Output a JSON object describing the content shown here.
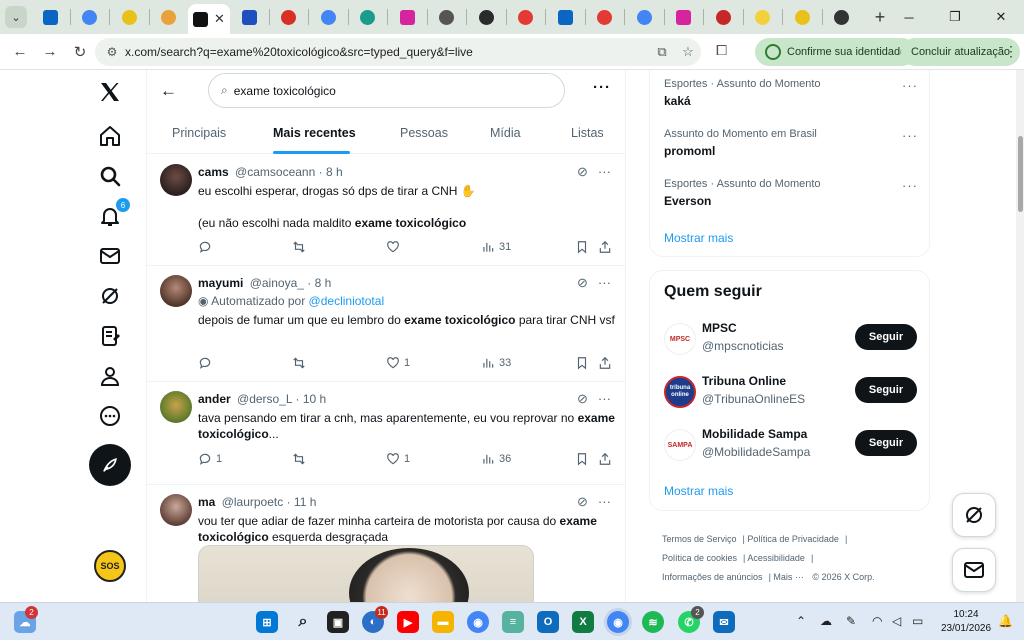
{
  "browser": {
    "tabs": [
      {
        "icon": "linkedin-icon",
        "color": "#0a66c2",
        "round": false
      },
      {
        "icon": "chrome-icon",
        "color": "#4285f4",
        "round": true
      },
      {
        "icon": "custom-icon",
        "color": "#e8c21a",
        "round": true
      },
      {
        "icon": "d-icon",
        "color": "#e9a23b",
        "round": true
      },
      {
        "icon": "x-icon",
        "color": "#111111",
        "round": false,
        "active": true
      },
      {
        "icon": "news-icon",
        "color": "#1f4fbf",
        "round": false
      },
      {
        "icon": "l-icon",
        "color": "#d93025",
        "round": true
      },
      {
        "icon": "google-icon",
        "color": "#4285f4",
        "round": true
      },
      {
        "icon": "globe-icon",
        "color": "#1a9c8c",
        "round": true
      },
      {
        "icon": "instagram-icon",
        "color": "#d6249f",
        "round": false
      },
      {
        "icon": "grid-icon",
        "color": "#555555",
        "round": true
      },
      {
        "icon": "dark-icon",
        "color": "#2b2b2b",
        "round": true
      },
      {
        "icon": "brand-icon",
        "color": "#e53935",
        "round": true
      },
      {
        "icon": "linkedin-icon",
        "color": "#0a66c2",
        "round": false
      },
      {
        "icon": "brand-icon",
        "color": "#e53935",
        "round": true
      },
      {
        "icon": "google-icon",
        "color": "#4285f4",
        "round": true
      },
      {
        "icon": "instagram-icon",
        "color": "#d6249f",
        "round": false
      },
      {
        "icon": "r-icon",
        "color": "#c62828",
        "round": true
      },
      {
        "icon": "yellow-icon",
        "color": "#f2d13a",
        "round": true
      },
      {
        "icon": "custom-icon",
        "color": "#e8c21a",
        "round": true
      },
      {
        "icon": "github-icon",
        "color": "#333333",
        "round": true
      }
    ],
    "new_tab": "+",
    "url": "x.com/search?q=exame%20toxicológico&src=typed_query&f=live",
    "identity_label": "Confirme sua identidade",
    "update_label": "Concluir atualização"
  },
  "search": {
    "query": "exame toxicológico"
  },
  "search_tabs": [
    {
      "label": "Principais",
      "active": false
    },
    {
      "label": "Mais recentes",
      "active": true
    },
    {
      "label": "Pessoas",
      "active": false
    },
    {
      "label": "Mídia",
      "active": false
    },
    {
      "label": "Listas",
      "active": false
    }
  ],
  "nav": {
    "notifications_badge": "6",
    "sos_label": "SOS"
  },
  "posts": [
    {
      "name": "cams",
      "handle": "@camsoceann",
      "time": "· 8 h",
      "text_line1": "eu escolhi esperar, drogas só dps de tirar a CNH ✋",
      "text_line2_pre": "(eu não escolhi nada maldito ",
      "text_line2_bold": "exame toxicológico",
      "replies": "",
      "reposts": "",
      "likes": "",
      "views": "31",
      "avatar_color": "#3a2a2a"
    },
    {
      "name": "mayumi",
      "handle": "@ainoya_",
      "time": "· 8 h",
      "automated_prefix": "Automatizado por ",
      "automated_link": "@decliniototal",
      "text_pre": "depois de fumar um que eu lembro do ",
      "text_bold": "exame toxicológico",
      "text_post": " para tirar CNH vsf",
      "replies": "",
      "reposts": "",
      "likes": "1",
      "views": "33",
      "avatar_color": "#6b4a3a"
    },
    {
      "name": "ander",
      "handle": "@derso_L",
      "time": "· 10 h",
      "text_pre": "tava pensando em tirar a cnh, mas aparentemente, eu vou reprovar no ",
      "text_bold": "exame toxicológico",
      "text_post": "...",
      "replies": "1",
      "reposts": "",
      "likes": "1",
      "views": "36",
      "avatar_color": "#c7a23a"
    },
    {
      "name": "ma",
      "handle": "@laurpoetc",
      "time": "· 11 h",
      "text_pre": "vou ter que adiar de fazer minha carteira de motorista por causa do ",
      "text_bold": "exame toxicológico",
      "text_post": " esquerda desgraçada",
      "avatar_color": "#8a6a5a"
    }
  ],
  "trends": [
    {
      "meta": "Esportes · Assunto do Momento",
      "name": "kaká"
    },
    {
      "meta": "Assunto do Momento em Brasil",
      "name": "promoml"
    },
    {
      "meta": "Esportes · Assunto do Momento",
      "name": "Everson"
    }
  ],
  "trends_show_more": "Mostrar mais",
  "who_to_follow": {
    "title": "Quem seguir",
    "accounts": [
      {
        "name": "MPSC",
        "handle": "@mpscnoticias",
        "button": "Seguir",
        "avatar_text": "MPSC",
        "avatar_color": "#ffffff",
        "avatar_fg": "#c62828"
      },
      {
        "name": "Tribuna Online",
        "handle": "@TribunaOnlineES",
        "button": "Seguir",
        "avatar_text": "tribuna online",
        "avatar_color": "#1e3c8c",
        "avatar_fg": "#ffffff"
      },
      {
        "name": "Mobilidade Sampa",
        "handle": "@MobilidadeSampa",
        "button": "Seguir",
        "avatar_text": "SAMPA",
        "avatar_color": "#ffffff",
        "avatar_fg": "#c62828"
      }
    ],
    "show_more": "Mostrar mais"
  },
  "footer": {
    "terms": "Termos de Serviço",
    "privacy": "Política de Privacidade",
    "cookies": "Política de cookies",
    "accessibility": "Acessibilidade",
    "ads": "Informações de anúncios",
    "more": "Mais ···",
    "copyright": "© 2026 X Corp."
  },
  "taskbar": {
    "badges": {
      "weather": "2",
      "app1": "11",
      "whatsapp": "2"
    },
    "time": "10:24",
    "date": "23/01/2026"
  },
  "colors": {
    "accent": "#1d9bf0",
    "text": "#0f1419",
    "secondary": "#536471",
    "follow_button": "#0f1419"
  }
}
